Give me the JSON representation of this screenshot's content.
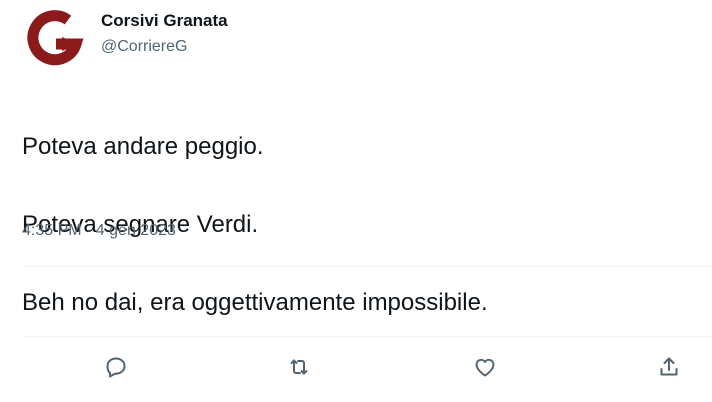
{
  "author": {
    "display_name": "Corsivi Granata",
    "handle": "@CorriereG",
    "avatar_letter": "G",
    "avatar_color": "#8b1a1a"
  },
  "tweet": {
    "lines": [
      "Poteva andare peggio.",
      "Poteva segnare Verdi.",
      "Beh no dai, era oggettivamente impossibile."
    ],
    "timestamp": "4:35 PM · 4 gen 2023"
  },
  "actions": [
    {
      "name": "reply",
      "icon": "reply-icon"
    },
    {
      "name": "retweet",
      "icon": "retweet-icon"
    },
    {
      "name": "like",
      "icon": "heart-icon"
    },
    {
      "name": "share",
      "icon": "share-icon"
    }
  ],
  "colors": {
    "text": "#0f1419",
    "secondary": "#536471",
    "divider": "#eff3f4"
  }
}
